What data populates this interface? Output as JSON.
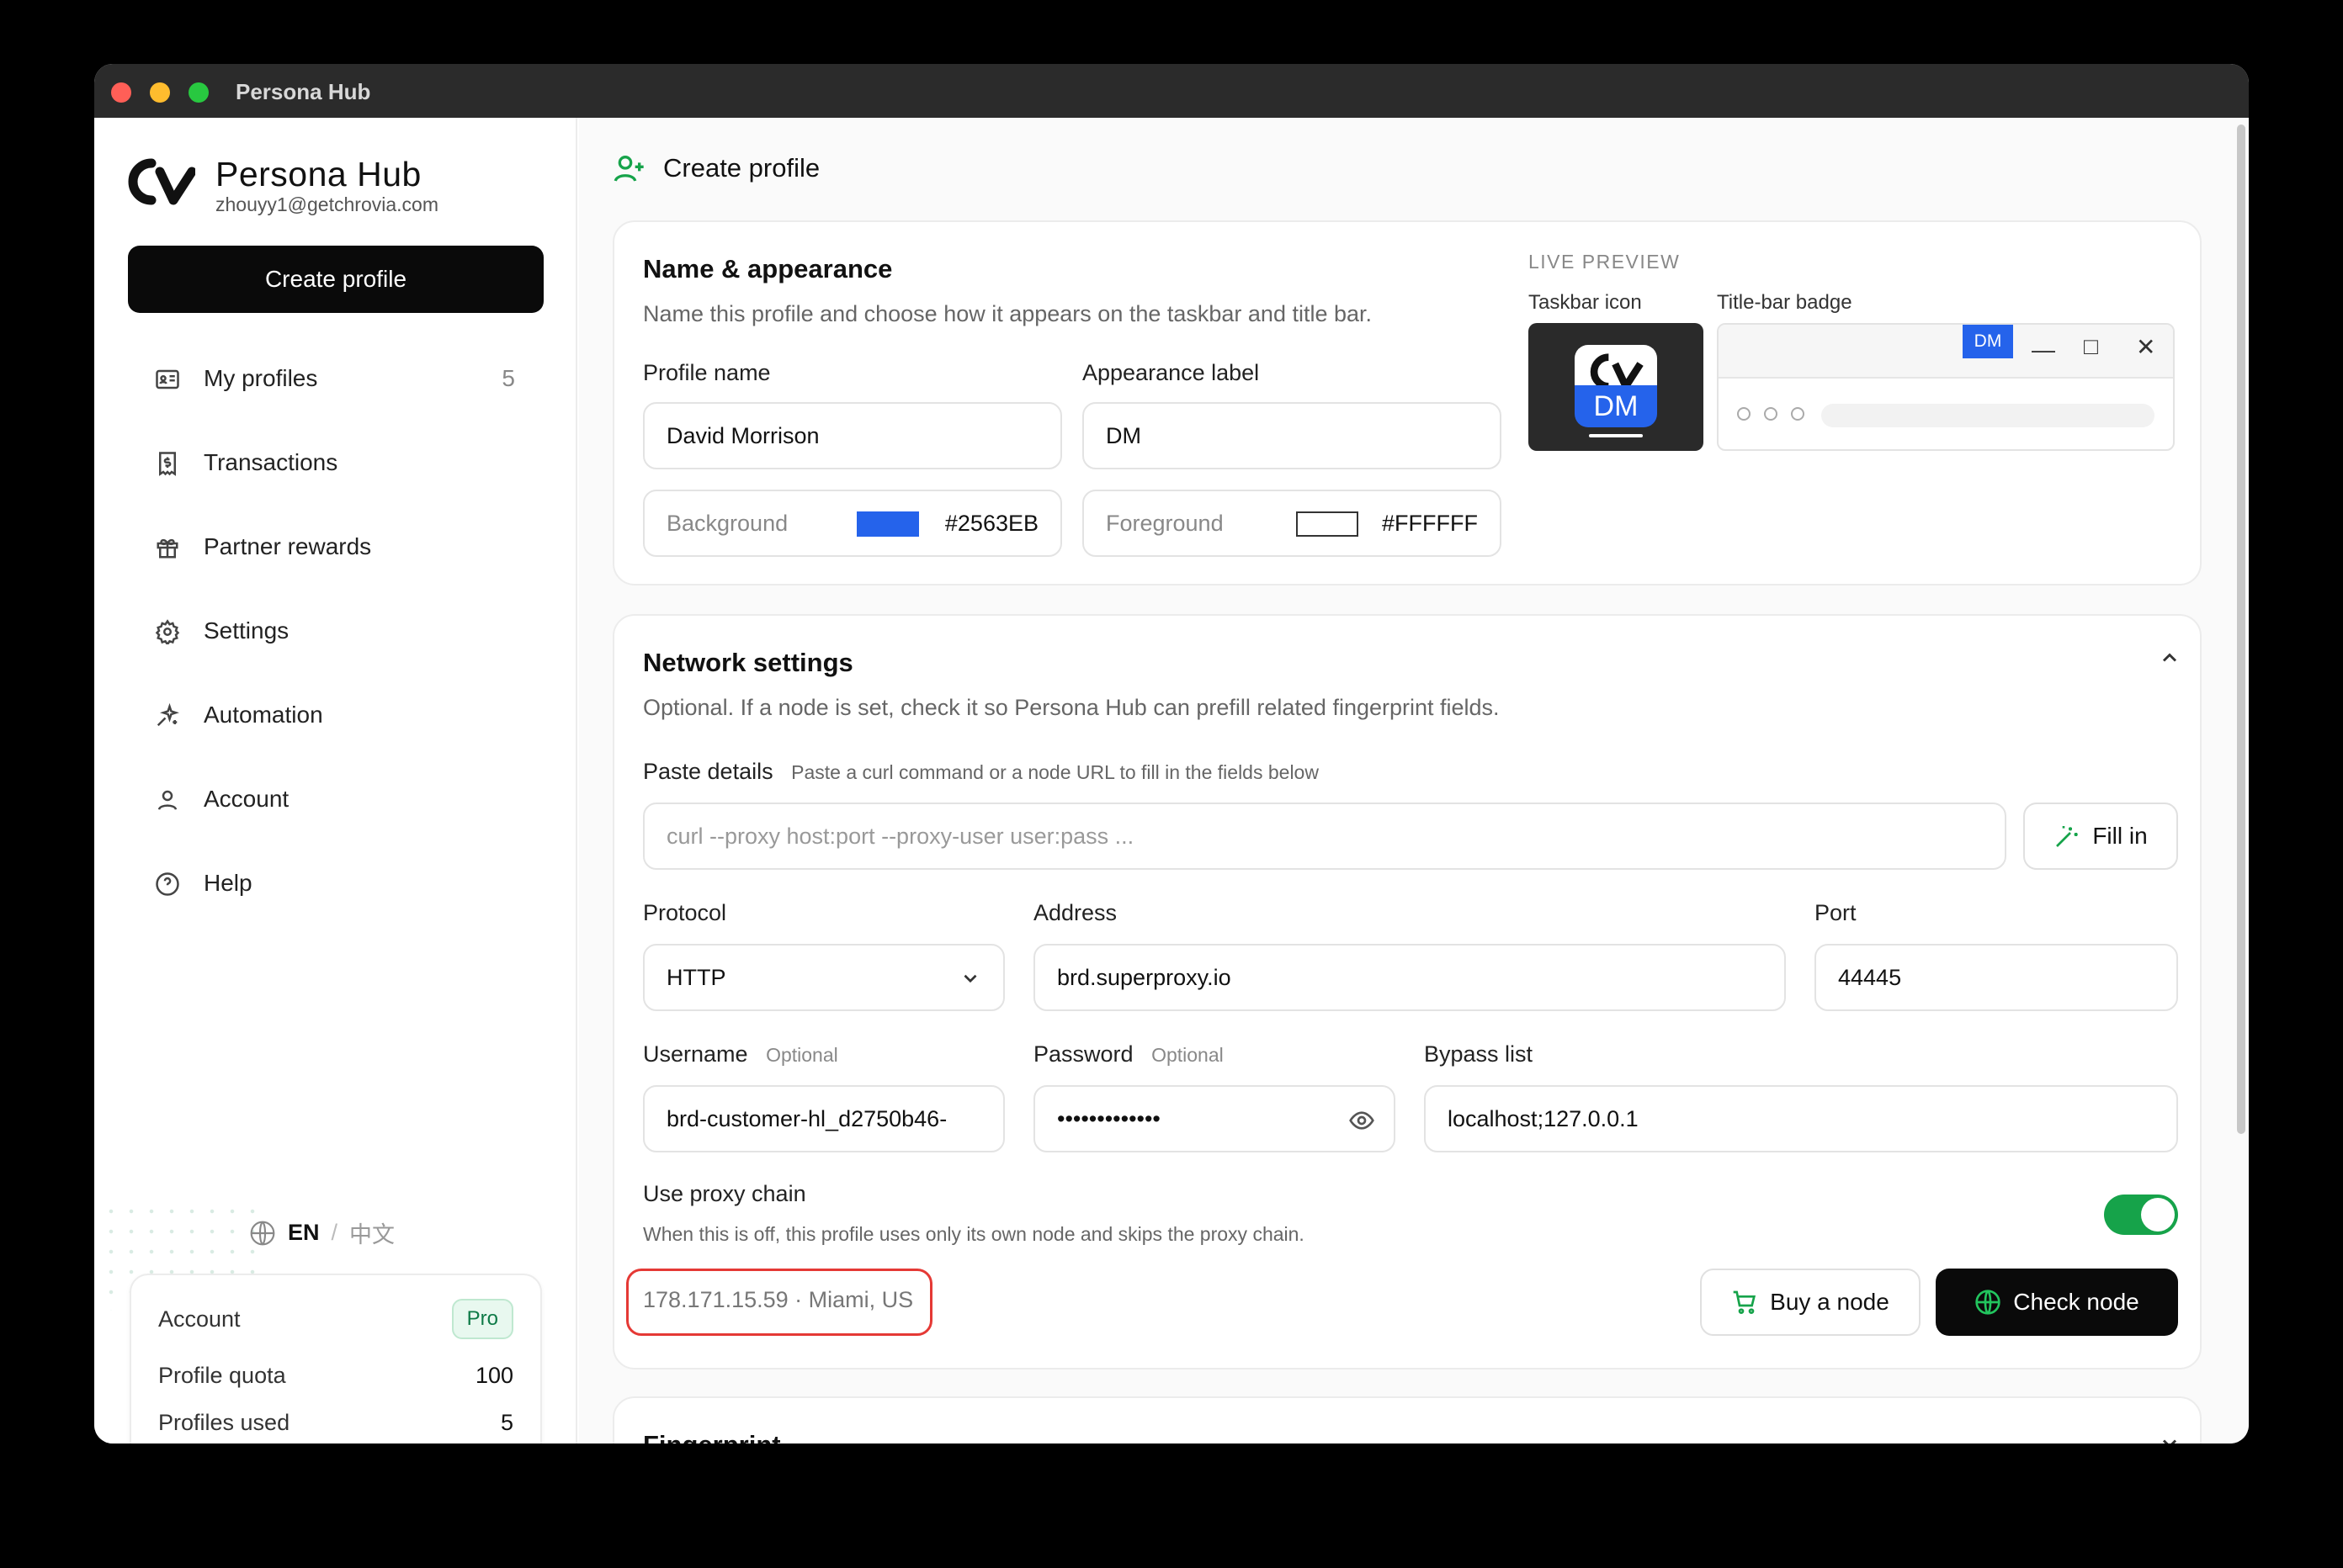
{
  "window": {
    "title": "Persona Hub"
  },
  "sidebar": {
    "brand": "Persona Hub",
    "email": "zhouyy1@getchrovia.com",
    "create_label": "Create profile",
    "items": [
      {
        "label": "My profiles",
        "count": "5",
        "icon": "id-card-icon"
      },
      {
        "label": "Transactions",
        "icon": "receipt-icon"
      },
      {
        "label": "Partner rewards",
        "icon": "gift-icon"
      },
      {
        "label": "Settings",
        "icon": "gear-icon"
      },
      {
        "label": "Automation",
        "icon": "sparkle-icon"
      },
      {
        "label": "Account",
        "icon": "user-icon"
      },
      {
        "label": "Help",
        "icon": "help-circle-icon"
      }
    ],
    "language": {
      "current": "EN",
      "separator": "/",
      "other": "中文"
    },
    "account_card": {
      "title": "Account",
      "badge": "Pro",
      "quota_label": "Profile quota",
      "quota_value": "100",
      "used_label": "Profiles used",
      "used_value": "5"
    }
  },
  "main": {
    "page_title": "Create profile",
    "name_section": {
      "title": "Name & appearance",
      "subtitle": "Name this profile and choose how it appears on the taskbar and title bar.",
      "profile_name_label": "Profile name",
      "profile_name_value": "David Morrison",
      "appearance_label": "Appearance label",
      "appearance_value": "DM",
      "background_label": "Background",
      "background_hex": "#2563EB",
      "foreground_label": "Foreground",
      "foreground_hex": "#FFFFFF",
      "live_preview": "LIVE PREVIEW",
      "taskbar_icon_label": "Taskbar icon",
      "titlebar_badge_label": "Title-bar badge",
      "badge_text": "DM"
    },
    "network_section": {
      "title": "Network settings",
      "subtitle": "Optional. If a node is set, check it so Persona Hub can prefill related fingerprint fields.",
      "paste_label": "Paste details",
      "paste_hint": "Paste a curl command or a node URL to fill in the fields below",
      "paste_placeholder": "curl --proxy host:port --proxy-user user:pass ...",
      "fill_in_label": "Fill in",
      "protocol_label": "Protocol",
      "protocol_value": "HTTP",
      "address_label": "Address",
      "address_value": "brd.superproxy.io",
      "port_label": "Port",
      "port_value": "44445",
      "username_label": "Username",
      "username_optional": "Optional",
      "username_value": "brd-customer-hl_d2750b46-",
      "password_label": "Password",
      "password_optional": "Optional",
      "password_value": "•••••••••••••",
      "bypass_label": "Bypass list",
      "bypass_value": "localhost;127.0.0.1",
      "proxy_chain_label": "Use proxy chain",
      "proxy_chain_desc": "When this is off, this profile uses only its own node and skips the proxy chain.",
      "proxy_chain_on": true,
      "ip_info": "178.171.15.59 · Miami, US",
      "buy_node_label": "Buy a node",
      "check_node_label": "Check node"
    },
    "fingerprint_section": {
      "title": "Fingerprint"
    }
  },
  "colors": {
    "accent": "#16a34a",
    "brand_blue": "#2563EB",
    "highlight_red": "#e53935"
  }
}
